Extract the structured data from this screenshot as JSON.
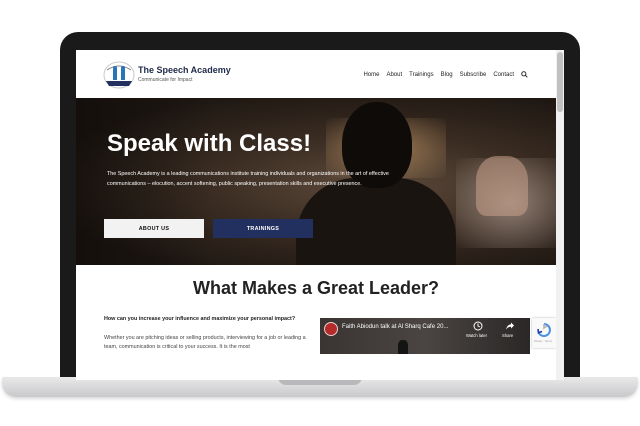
{
  "brand": {
    "name": "The Speech Academy",
    "tagline": "Communicate for Impact"
  },
  "nav": {
    "items": [
      "Home",
      "About",
      "Trainings",
      "Blog",
      "Subscribe",
      "Contact"
    ],
    "search_icon": "search-icon"
  },
  "hero": {
    "title": "Speak with Class!",
    "description": "The Speech Academy is a leading communications institute training individuals and organizations in the art of effective communications – elocution, accent softening, public speaking, presentation skills and executive presence.",
    "buttons": {
      "about": "ABOUT US",
      "trainings": "TRAININGS"
    }
  },
  "section": {
    "title": "What Makes a Great Leader?",
    "question": "How can you increase your influence and maximize your personal impact?",
    "body": "Whether you are pitching ideas or selling products, interviewing for a job or leading a team, communication is critical to your success. It is the most"
  },
  "video": {
    "title": "Faith Abiodun talk at Al Sharq Cafe 20...",
    "watch_later": "Watch later",
    "share": "Share"
  },
  "recaptcha": {
    "text": "Privacy · Terms"
  },
  "colors": {
    "brand_navy": "#22305f",
    "laptop_frame": "#1a1a1a"
  }
}
